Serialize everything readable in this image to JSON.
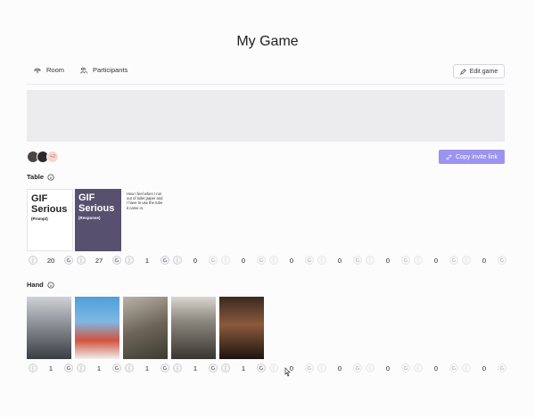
{
  "header": {
    "title": "My Game"
  },
  "tabs": [
    {
      "label": "Room",
      "icon": "umbrella-icon"
    },
    {
      "label": "Participants",
      "icon": "users-icon"
    }
  ],
  "toolbar": {
    "edit_label": "Edit game",
    "invite_label": "Copy invite link"
  },
  "participants": {
    "extra_count": "+2"
  },
  "table": {
    "label": "Table",
    "prompt_card": {
      "big": "GIF Serious",
      "small": "(Prompt)"
    },
    "response_card": {
      "big": "GIF Serious",
      "small": "(Response)"
    },
    "text_card": "How I feel when I run out of toilet paper and I have to use the tube it came in.",
    "counts": [
      "20",
      "27",
      "1",
      "0",
      "0",
      "0",
      "0",
      "0",
      "0",
      "0"
    ]
  },
  "hand": {
    "label": "Hand",
    "counts": [
      "1",
      "1",
      "1",
      "1",
      "1",
      "0",
      "0",
      "0",
      "0",
      "0"
    ]
  },
  "colors": {
    "accent": "#9b93ee",
    "response_card": "#57506e"
  }
}
